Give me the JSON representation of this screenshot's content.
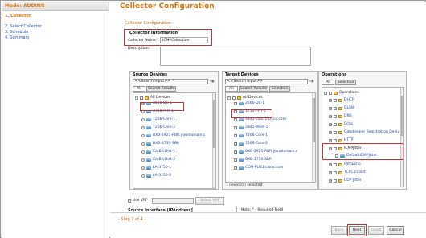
{
  "sidebar": {
    "mode": "Mode: ADDING",
    "steps": [
      {
        "label": "1. Collector"
      },
      {
        "label": "2. Select Collector"
      },
      {
        "label": "3. Schedule"
      },
      {
        "label": "4. Summary"
      }
    ]
  },
  "header": {
    "title": "Collector Configuration",
    "subtitle": "Collector Configuration"
  },
  "collector": {
    "group_title": "Collector Information",
    "name_label": "Collector Name*:",
    "name_value": "ICMPCollection",
    "description_label": "Description:"
  },
  "source": {
    "title": "Source Devices",
    "search_placeholder": "<<Search Input>>",
    "tabs": [
      "All",
      "Search Results"
    ],
    "root": "All Devices",
    "devices": [
      "3560-DC-1",
      "3750-PHY-1",
      "7206-Core-1",
      "7206-Core-2",
      "BXB-2921-RBR.yourdomain.c",
      "BXB-3750-SBR",
      "CatBK-Dist-1",
      "CatBK-Dist-2",
      "LA-3750-1",
      "LA-3750-2"
    ]
  },
  "target": {
    "title": "Target Devices",
    "search_placeholder": "<<Search Input>>",
    "tabs": [
      "All",
      "Search Results",
      "Selection"
    ],
    "root": "All Devices",
    "devices": [
      "3560-DC-1",
      "3750-PHY-1",
      "3845-East-1.cisco.com",
      "3845-West-1",
      "7206-Core-1",
      "7206-Core-2",
      "BXB-2921-RBR.yourdomain.c",
      "BXB-3750-SBR",
      "CCM-PUB1.cisco.com"
    ],
    "status": "1 device(s) selected"
  },
  "operations": {
    "title": "Operations",
    "tabs": [
      "All",
      "Selection"
    ],
    "root": "Operations",
    "items": [
      "DHCP",
      "DLSW",
      "DNS",
      "Echo",
      "Gatekeeper Registration Delay",
      "HTTP",
      "ICMPJitter",
      "DefaultICMPJitter",
      "PathEcho",
      "TCPConnect",
      "UDP Jitter"
    ]
  },
  "vrf": {
    "checkbox_label": "Use VRF",
    "button": "Select VRF"
  },
  "source_interface": {
    "label": "Source Interface (IPAddress):",
    "value": "",
    "note": "Note: * - Required Field"
  },
  "footer": {
    "step_text": "- Step 1 of 4 -",
    "buttons": {
      "back": "Back",
      "next": "Next",
      "finish": "Finish",
      "cancel": "Cancel"
    }
  }
}
